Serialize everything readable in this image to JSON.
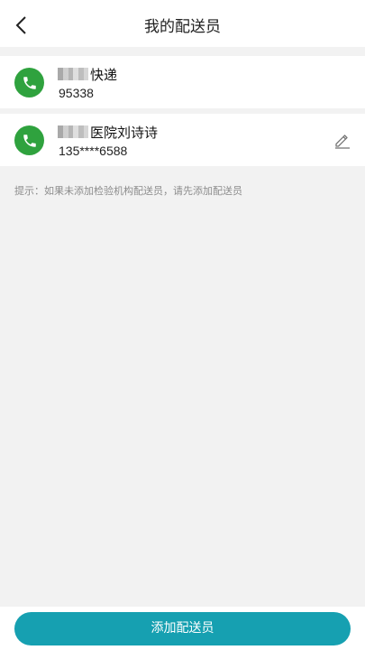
{
  "header": {
    "title": "我的配送员",
    "back_icon": "chevron-left-icon"
  },
  "couriers": [
    {
      "name_suffix": "快递",
      "phone": "95338",
      "call_icon": "phone-icon",
      "editable": false
    },
    {
      "name_suffix": "医院刘诗诗",
      "phone": "135****6588",
      "call_icon": "phone-icon",
      "edit_icon": "pencil-icon",
      "editable": true
    }
  ],
  "hint": "提示：如果未添加检验机构配送员，请先添加配送员",
  "footer": {
    "add_button_label": "添加配送员"
  },
  "colors": {
    "call_button": "#2fa23e",
    "primary_button": "#16a0b1",
    "page_background": "#f2f2f2"
  }
}
